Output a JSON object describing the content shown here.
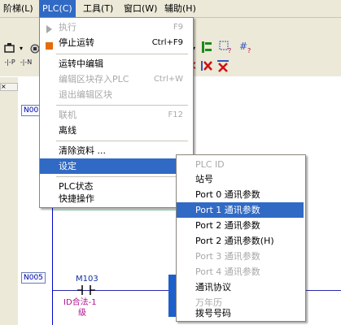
{
  "menubar": {
    "items": [
      {
        "label": "阶梯(L)"
      },
      {
        "label": "PLC(C)"
      },
      {
        "label": "工具(T)"
      },
      {
        "label": "窗口(W)"
      },
      {
        "label": "辅助(H)"
      }
    ]
  },
  "left_tab": {
    "label": "×"
  },
  "editor": {
    "rungs": [
      "N00",
      "N005"
    ],
    "contact_name": "M103",
    "contact_comment_line1": "ID合法-1",
    "contact_comment_line2": "级"
  },
  "plc_menu": {
    "items": [
      {
        "label": "执行",
        "shortcut": "F9",
        "disabled": true
      },
      {
        "label": "停止运转",
        "shortcut": "Ctrl+F9",
        "disabled": false
      },
      {
        "label": "运转中编辑",
        "shortcut": "",
        "disabled": false
      },
      {
        "label": "编辑区块存入PLC",
        "shortcut": "Ctrl+W",
        "disabled": true
      },
      {
        "label": "退出编辑区块",
        "shortcut": "",
        "disabled": true
      },
      {
        "label": "联机",
        "shortcut": "F12",
        "disabled": true
      },
      {
        "label": "离线",
        "shortcut": "",
        "disabled": false
      },
      {
        "label": "清除资料 ...",
        "shortcut": "",
        "disabled": false
      },
      {
        "label": "设定",
        "shortcut": "",
        "disabled": false,
        "submenu_arrow": "▶"
      },
      {
        "label": "PLC状态",
        "shortcut": "",
        "disabled": false
      },
      {
        "label": "快捷操作",
        "shortcut": "",
        "disabled": false,
        "submenu_arrow": "▶"
      }
    ]
  },
  "settings_submenu": {
    "items": [
      {
        "label": "PLC ID",
        "disabled": true
      },
      {
        "label": "站号",
        "disabled": false
      },
      {
        "label": "Port 0 通讯参数",
        "disabled": false
      },
      {
        "label": "Port 1 通讯参数",
        "disabled": false
      },
      {
        "label": "Port 2 通讯参数",
        "disabled": false
      },
      {
        "label": "Port 2 通讯参数(H)",
        "disabled": false
      },
      {
        "label": "Port 3 通讯参数",
        "disabled": true
      },
      {
        "label": "Port 4 通讯参数",
        "disabled": true
      },
      {
        "label": "通讯协议",
        "disabled": false
      },
      {
        "label": "万年历",
        "disabled": true
      },
      {
        "label": "拨号号码",
        "disabled": false
      }
    ]
  },
  "toolbar": {
    "row2_icons": [
      "-|-P",
      "-|-N"
    ],
    "colors": {
      "accent": "#316ac5",
      "stop": "#e46c0a",
      "delete": "#d01010",
      "green": "#1a8a1a"
    }
  }
}
